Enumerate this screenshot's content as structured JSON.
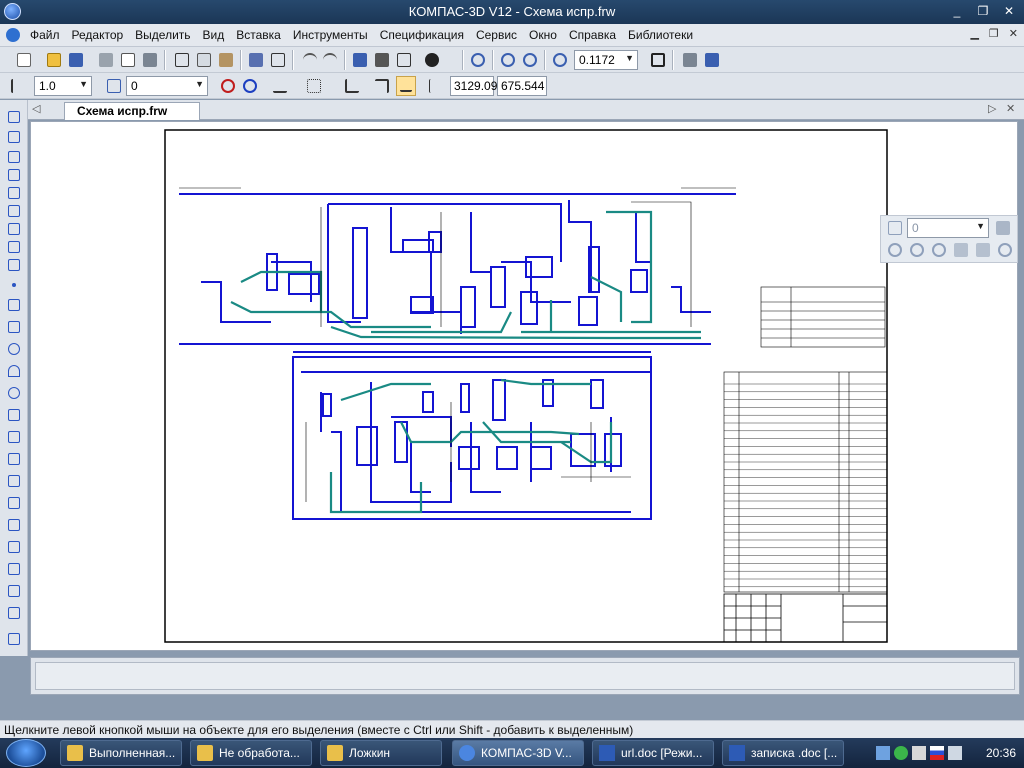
{
  "window": {
    "title": "КОМПАС-3D V12 - Схема испр.frw",
    "min": "_",
    "restore": "❐",
    "close": "✕"
  },
  "menu": {
    "items": [
      "Файл",
      "Редактор",
      "Выделить",
      "Вид",
      "Вставка",
      "Инструменты",
      "Спецификация",
      "Сервис",
      "Окно",
      "Справка",
      "Библиотеки"
    ]
  },
  "toolbar1": {
    "scale": "0.1172"
  },
  "toolbar2": {
    "line_style": "1.0",
    "layer": "0",
    "coord_x": "3129.09",
    "coord_y": "675.544"
  },
  "doc_tab": {
    "label": "Схема испр.frw"
  },
  "float_panel": {
    "layer": "0"
  },
  "status": {
    "text": "Щелкните левой кнопкой мыши на объекте для его выделения (вместе с Ctrl или Shift - добавить к выделенным)"
  },
  "taskbar": {
    "tasks": [
      {
        "label": "Выполненная...",
        "icon": "folder-icon"
      },
      {
        "label": "Не обработа...",
        "icon": "folder-icon"
      },
      {
        "label": "Ложкин",
        "icon": "folder-icon"
      },
      {
        "label": "КОМПАС-3D V...",
        "icon": "kompas-icon"
      },
      {
        "label": "url.doc [Режи...",
        "icon": "word-icon"
      },
      {
        "label": "записка .doc [...",
        "icon": "word-icon"
      }
    ],
    "clock": "20:36"
  },
  "colors": {
    "pipe_blue": "#1414d2",
    "pipe_teal": "#1a8a84",
    "frame": "#000000",
    "titlebar": "#1f3d63"
  }
}
